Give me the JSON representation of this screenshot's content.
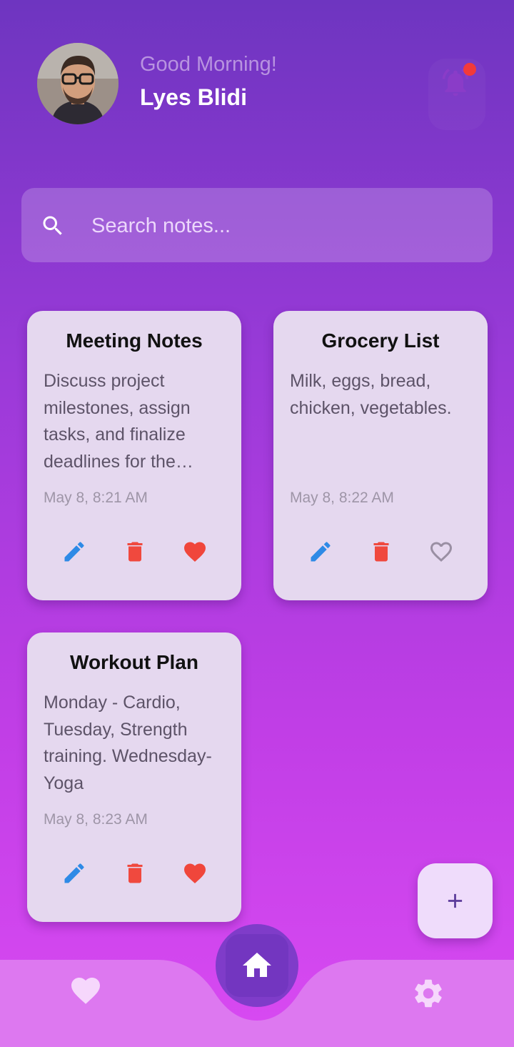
{
  "header": {
    "greeting": "Good Morning!",
    "username": "Lyes Blidi",
    "avatar_icon": "user-photo",
    "notification_icon": "bell-icon",
    "notification_dot_color": "#f23a3a"
  },
  "search": {
    "placeholder": "Search notes...",
    "value": ""
  },
  "notes": [
    {
      "title": "Meeting Notes",
      "body": "Discuss project milestones, assign tasks, and finalize deadlines for the upcoming release.",
      "date": "May 8, 8:21 AM",
      "favorite": true
    },
    {
      "title": "Grocery List",
      "body": "Milk, eggs, bread, chicken, vegetables.",
      "date": "May 8, 8:22 AM",
      "favorite": false
    },
    {
      "title": "Workout Plan",
      "body": "Monday - Cardio, Tuesday, Strength training. Wednesday- Yoga",
      "date": "May 8, 8:23 AM",
      "favorite": true
    }
  ],
  "actions": {
    "edit_icon": "pencil-icon",
    "delete_icon": "trash-icon",
    "favorite_icon": "heart-icon",
    "edit_color": "#2e8ae6",
    "delete_color": "#f0493e",
    "favorite_color": "#f0463b"
  },
  "fab": {
    "icon": "plus-icon"
  },
  "nav": {
    "items": [
      {
        "icon": "heart-icon",
        "active": false
      },
      {
        "icon": "home-icon",
        "active": true
      },
      {
        "icon": "gear-icon",
        "active": false
      }
    ]
  },
  "colors": {
    "background_top": "#6e35c0",
    "background_bottom": "#d94af2",
    "card": "#e5d8ef",
    "accent": "#7f3cc9"
  }
}
